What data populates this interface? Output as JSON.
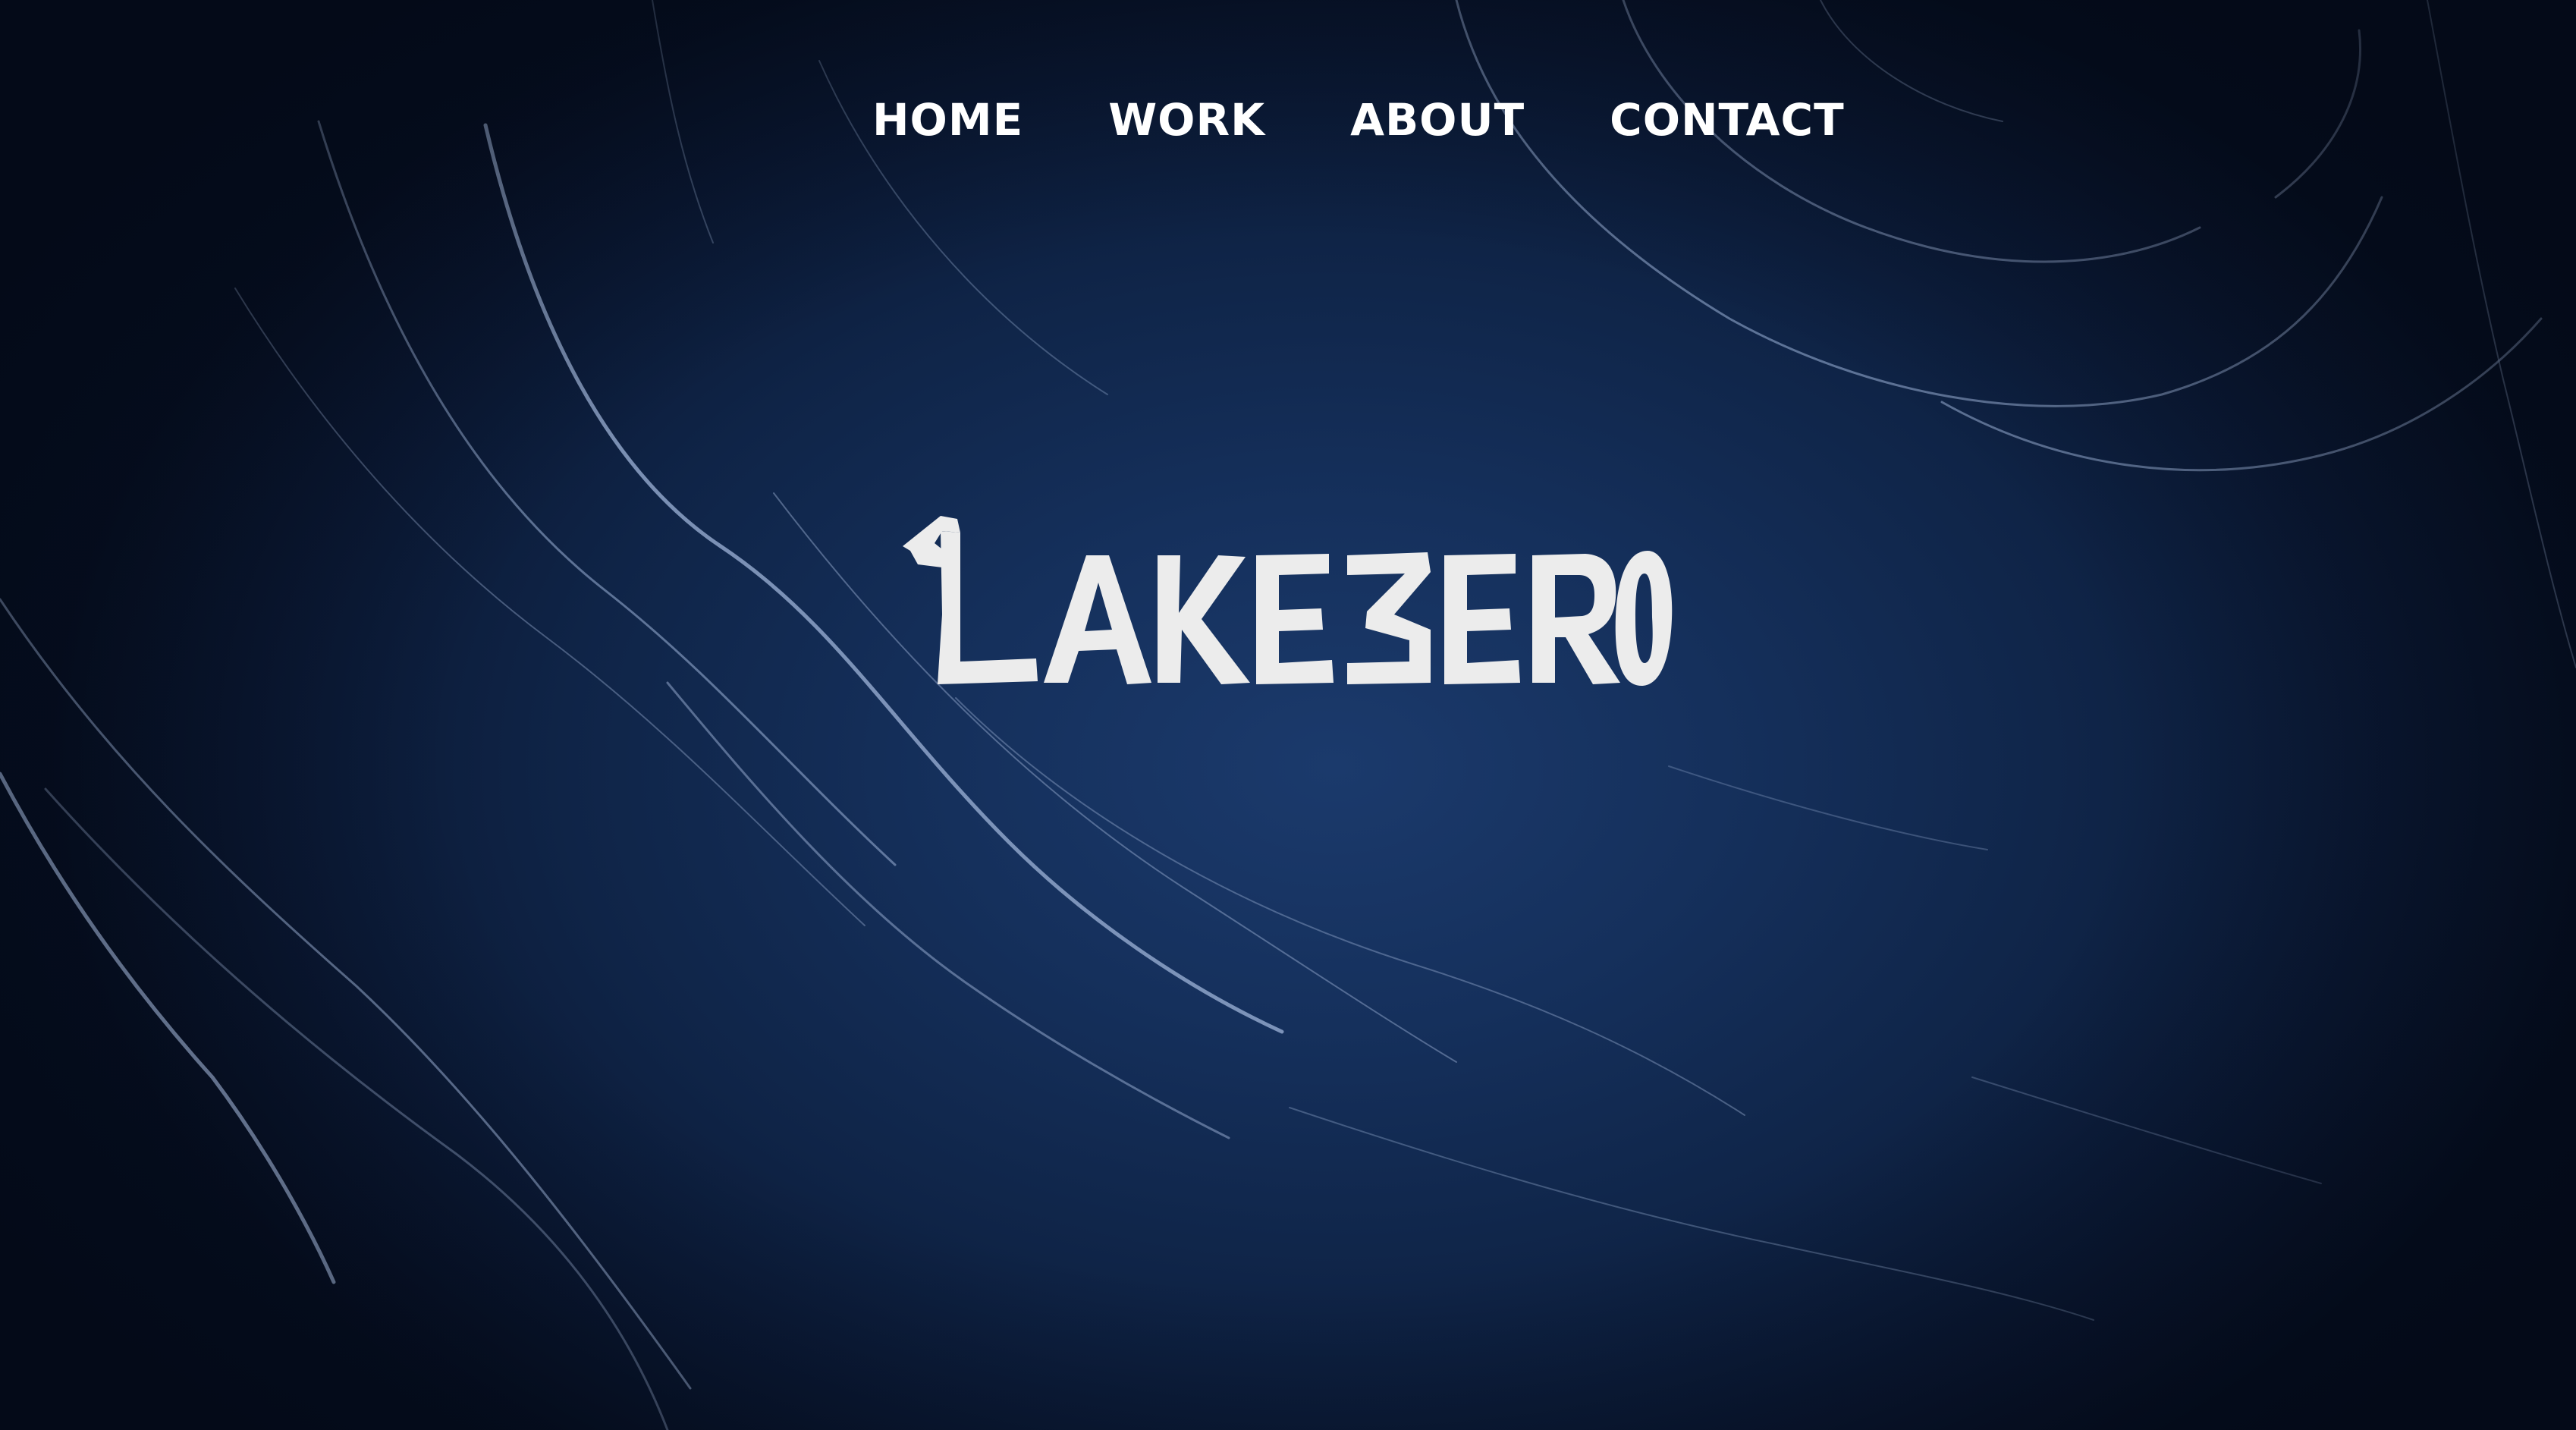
{
  "nav": {
    "items": [
      {
        "label": "HOME"
      },
      {
        "label": "WORK"
      },
      {
        "label": "ABOUT"
      },
      {
        "label": "CONTACT"
      }
    ]
  },
  "logo": {
    "text": "LAKEZERO"
  },
  "colors": {
    "background": "#15305c",
    "trail": "#9fb4d8",
    "nav_text": "#ffffff",
    "logo": "#ececec"
  }
}
